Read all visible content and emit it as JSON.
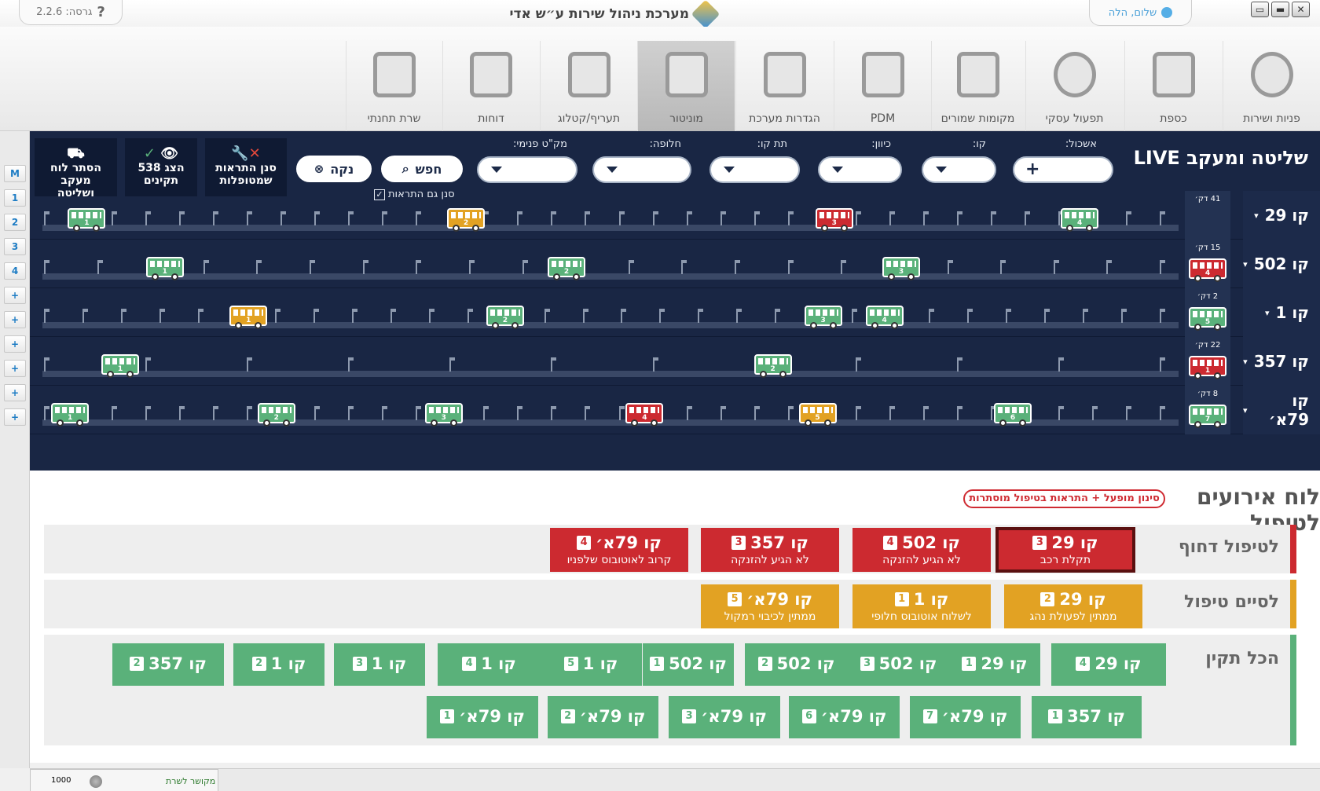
{
  "app": {
    "title": "מערכת ניהול שירות ע״ש אדי",
    "version": "גרסה: 2.2.6",
    "help_icon": "question-icon",
    "greeting": "שלום, הלה",
    "win_icons": [
      "restore-icon",
      "minimize-icon",
      "close-icon"
    ]
  },
  "toolbar": [
    {
      "label": "פניות ושירות",
      "icon": "user-icon"
    },
    {
      "label": "כספת",
      "icon": "safe-icon"
    },
    {
      "label": "תפעול עסקי",
      "icon": "gears-icon"
    },
    {
      "label": "מקומות שמורים",
      "icon": "id-card-icon"
    },
    {
      "label": "PDM",
      "icon": "binder-icon"
    },
    {
      "label": "הגדרות מערכת",
      "icon": "tools-icon"
    },
    {
      "label": "מוניטור",
      "icon": "monitor-icon",
      "active": true
    },
    {
      "label": "תעריף/קטלוג",
      "icon": "tag-icon"
    },
    {
      "label": "דוחות",
      "icon": "report-icon"
    },
    {
      "label": "שרת תחנתי",
      "icon": "server-icon"
    }
  ],
  "side_buttons": [
    "M",
    "1",
    "2",
    "3",
    "4",
    "+",
    "+",
    "+",
    "+",
    "+",
    "+"
  ],
  "panel": {
    "title": "שליטה ומעקב LIVE",
    "filters": {
      "cluster": "אשכול:",
      "line": "קו:",
      "direction": "כיוון:",
      "subline": "תת קו:",
      "alternative": "חלופה:",
      "internal_code": "מק\"ט פנימי:"
    },
    "search_label": "חפש",
    "clear_label": "נקה",
    "filter_alerts_checkbox": "סנן גם התראות",
    "buttons": {
      "filter_handled": "סנן התראות שמטופלות",
      "show_ok": "הצג 538 תקינים",
      "hide_board": "הסתר לוח מעקב ושליטה"
    }
  },
  "lines": [
    {
      "name": "קו 29",
      "eta": "41 דק׳",
      "eta_bus": null,
      "buses": [
        {
          "n": "1",
          "status": "ok",
          "pos": 0.02
        },
        {
          "n": "2",
          "status": "warn",
          "pos": 0.36
        },
        {
          "n": "3",
          "status": "alert",
          "pos": 0.69
        },
        {
          "n": "4",
          "status": "ok",
          "pos": 0.91
        }
      ]
    },
    {
      "name": "קו 502",
      "eta": "15 דק׳",
      "eta_bus": {
        "n": "4",
        "status": "alert"
      },
      "buses": [
        {
          "n": "1",
          "status": "ok",
          "pos": 0.09
        },
        {
          "n": "2",
          "status": "ok",
          "pos": 0.45
        },
        {
          "n": "3",
          "status": "ok",
          "pos": 0.75
        }
      ]
    },
    {
      "name": "קו 1",
      "eta": "2 דק׳",
      "eta_bus": {
        "n": "5",
        "status": "ok"
      },
      "buses": [
        {
          "n": "1",
          "status": "warn",
          "pos": 0.165
        },
        {
          "n": "2",
          "status": "ok",
          "pos": 0.395
        },
        {
          "n": "3",
          "status": "ok",
          "pos": 0.68
        },
        {
          "n": "4",
          "status": "ok",
          "pos": 0.735
        }
      ]
    },
    {
      "name": "קו 357",
      "eta": "22 דק׳",
      "eta_bus": {
        "n": "1",
        "status": "alert"
      },
      "buses": [
        {
          "n": "1",
          "status": "ok",
          "pos": 0.05
        },
        {
          "n": "2",
          "status": "ok",
          "pos": 0.635
        }
      ]
    },
    {
      "name": "קו 79א׳",
      "eta": "8 דק׳",
      "eta_bus": {
        "n": "7",
        "status": "ok"
      },
      "buses": [
        {
          "n": "1",
          "status": "ok",
          "pos": 0.005
        },
        {
          "n": "2",
          "status": "ok",
          "pos": 0.19
        },
        {
          "n": "3",
          "status": "ok",
          "pos": 0.34
        },
        {
          "n": "4",
          "status": "alert",
          "pos": 0.52
        },
        {
          "n": "5",
          "status": "warn",
          "pos": 0.675
        },
        {
          "n": "6",
          "status": "ok",
          "pos": 0.85
        }
      ]
    }
  ],
  "events": {
    "title": "לוח אירועים לטיפול",
    "filter_note": "סינון מופעל + התראות בטיפול מוסתרות",
    "urgent_label": "לטיפול דחוף",
    "finish_label": "לסיים טיפול",
    "ok_label": "הכל תקין",
    "urgent": [
      {
        "line": "קו 29",
        "n": "3",
        "desc": "תקלת רכב",
        "selected": true
      },
      {
        "line": "קו 502",
        "n": "4",
        "desc": "לא הגיע להזנקה"
      },
      {
        "line": "קו 357",
        "n": "3",
        "desc": "לא הגיע להזנקה"
      },
      {
        "line": "קו 79א׳",
        "n": "4",
        "desc": "קרוב לאוטובוס שלפניו"
      }
    ],
    "finish": [
      {
        "line": "קו 29",
        "n": "2",
        "desc": "ממתין לפעולת נהג"
      },
      {
        "line": "קו 1",
        "n": "1",
        "desc": "לשלוח אוטובוס חלופי"
      },
      {
        "line": "קו 79א׳",
        "n": "5",
        "desc": "ממתין לכיבוי רמקול"
      }
    ],
    "ok_row1": [
      {
        "line": "קו 29",
        "n": "4"
      },
      {
        "line": "קו 29",
        "n": "1"
      },
      {
        "line": "קו 502",
        "n": "3"
      },
      {
        "line": "קו 502",
        "n": "2"
      },
      {
        "line": "קו 502",
        "n": "1"
      },
      {
        "line": "קו 1",
        "n": "5"
      },
      {
        "line": "קו 1",
        "n": "4"
      },
      {
        "line": "קו 1",
        "n": "3"
      },
      {
        "line": "קו 1",
        "n": "2"
      },
      {
        "line": "קו 357",
        "n": "2"
      }
    ],
    "ok_row2": [
      {
        "line": "קו 357",
        "n": "1"
      },
      {
        "line": "קו 79א׳",
        "n": "7"
      },
      {
        "line": "קו 79א׳",
        "n": "6"
      },
      {
        "line": "קו 79א׳",
        "n": "3"
      },
      {
        "line": "קו 79א׳",
        "n": "2"
      },
      {
        "line": "קו 79א׳",
        "n": "1"
      }
    ]
  },
  "status_bar": {
    "connection": "מקושר לשרת",
    "value": "1000"
  },
  "colors": {
    "ok": "#5ab17a",
    "warn": "#e2a223",
    "alert": "#cc2a30",
    "panel": "#192644"
  }
}
